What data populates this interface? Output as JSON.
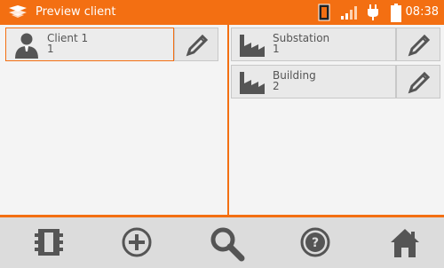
{
  "status_bar": {
    "title": "Preview client",
    "time": "08:38",
    "icons": [
      "app-logo-icon",
      "memory-card-icon",
      "signal-icon",
      "power-plug-icon",
      "battery-icon"
    ]
  },
  "left_pane": {
    "items": [
      {
        "name": "Client 1",
        "number": "1",
        "icon": "client-person-icon",
        "selected": true
      }
    ]
  },
  "right_pane": {
    "items": [
      {
        "name": "Substation",
        "number": "1",
        "icon": "factory-icon"
      },
      {
        "name": "Building",
        "number": "2",
        "icon": "factory-icon"
      }
    ]
  },
  "toolbar": {
    "buttons": [
      "memory-icon",
      "add-icon",
      "search-icon",
      "help-icon",
      "home-icon"
    ]
  },
  "colors": {
    "accent": "#f36f12",
    "icon_gray": "#555555",
    "background": "#f4f4f4"
  }
}
